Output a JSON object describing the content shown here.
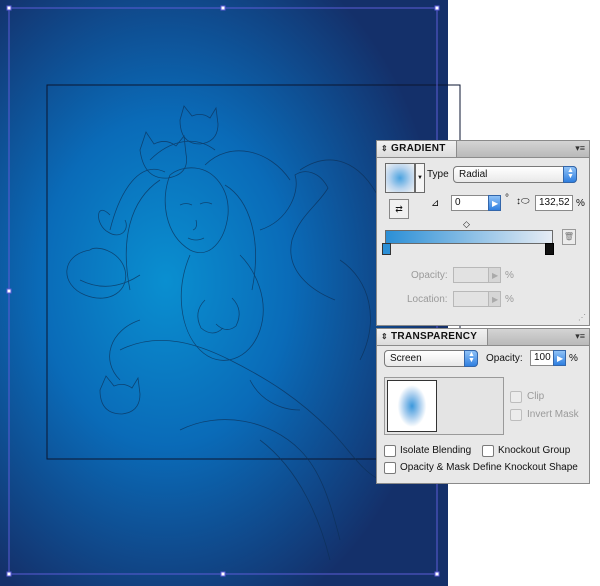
{
  "gradient_panel": {
    "tab_title": "GRADIENT",
    "type_label": "Type",
    "type_value": "Radial",
    "angle_value": "0",
    "degree_symbol": "°",
    "aspect_value": "132,52",
    "aspect_unit": "%",
    "opacity_label": "Opacity:",
    "opacity_value": "",
    "opacity_unit": "%",
    "location_label": "Location:",
    "location_value": "",
    "location_unit": "%",
    "ramp_start_color": "#2b8fd6",
    "ramp_end_color": "#e6ecf4"
  },
  "transparency_panel": {
    "tab_title": "TRANSPARENCY",
    "blend_mode": "Screen",
    "opacity_label": "Opacity:",
    "opacity_value": "100",
    "opacity_unit": "%",
    "clip_label": "Clip",
    "invert_mask_label": "Invert Mask",
    "isolate_blending_label": "Isolate Blending",
    "knockout_group_label": "Knockout Group",
    "opacity_mask_label": "Opacity & Mask Define Knockout Shape"
  },
  "colors": {
    "canvas_dark": "#14306a",
    "canvas_center": "#0a8fd0",
    "selection_blue": "#5b5bd6",
    "accent": "#2f7fe0"
  }
}
